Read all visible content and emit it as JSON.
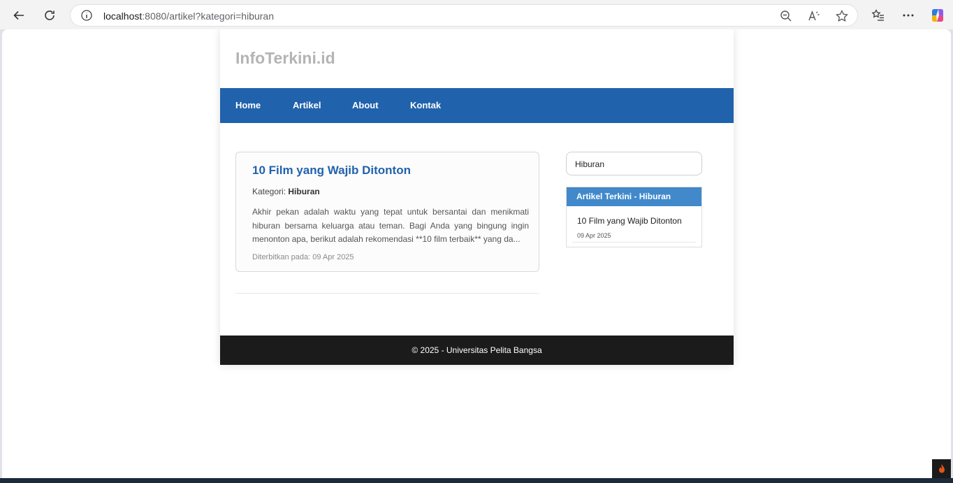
{
  "browser": {
    "url_host": "localhost",
    "url_rest": ":8080/artikel?kategori=hiburan"
  },
  "site": {
    "logo": "InfoTerkini.id",
    "nav": [
      "Home",
      "Artikel",
      "About",
      "Kontak"
    ],
    "article": {
      "title": "10 Film yang Wajib Ditonton",
      "category_label": "Kategori:",
      "category": "Hiburan",
      "excerpt": "Akhir pekan adalah waktu yang tepat untuk bersantai dan menikmati hiburan bersama keluarga atau teman. Bagi Anda yang bingung ingin menonton apa, berikut adalah rekomendasi **10 film terbaik** yang da...",
      "published": "Diterbitkan pada: 09 Apr 2025"
    },
    "sidebar": {
      "search_value": "Hiburan",
      "widget_title": "Artikel Terkini - Hiburan",
      "items": [
        {
          "title": "10 Film yang Wajib Ditonton",
          "date": "09 Apr 2025"
        }
      ]
    },
    "footer": "© 2025 - Universitas Pelita Bangsa"
  },
  "colors": {
    "nav_bg": "#2162ac",
    "widget_head": "#4189cb",
    "footer_bg": "#1b1b1b",
    "logo": "#b4b4b4"
  }
}
